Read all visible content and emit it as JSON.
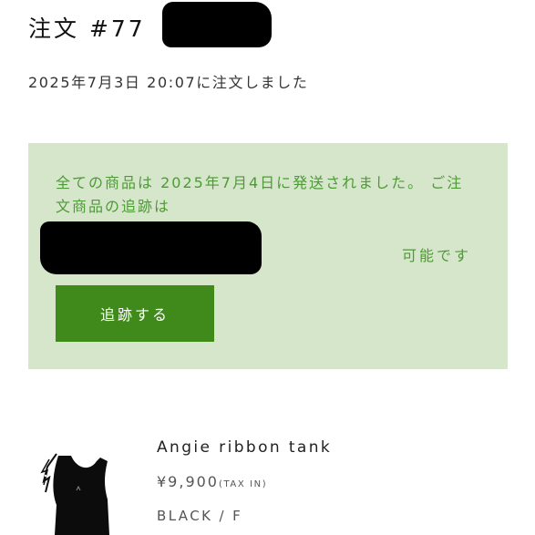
{
  "order": {
    "title": "注文 #77",
    "date_text": "2025年7月3日 20:07に注文しました"
  },
  "notice": {
    "message": "全ての商品は 2025年7月4日に発送されました。 ご注文商品の追跡は",
    "available_text": "可能です",
    "track_button_label": "追跡する",
    "colors": {
      "background": "#d5e6cb",
      "text": "#4e9a36",
      "button": "#3f8a1a"
    }
  },
  "product": {
    "name": "Angie ribbon tank",
    "price": "¥9,900",
    "tax_label": "(TAX IN)",
    "variant": "BLACK / F",
    "image_icon": "black-tank-top-image"
  }
}
